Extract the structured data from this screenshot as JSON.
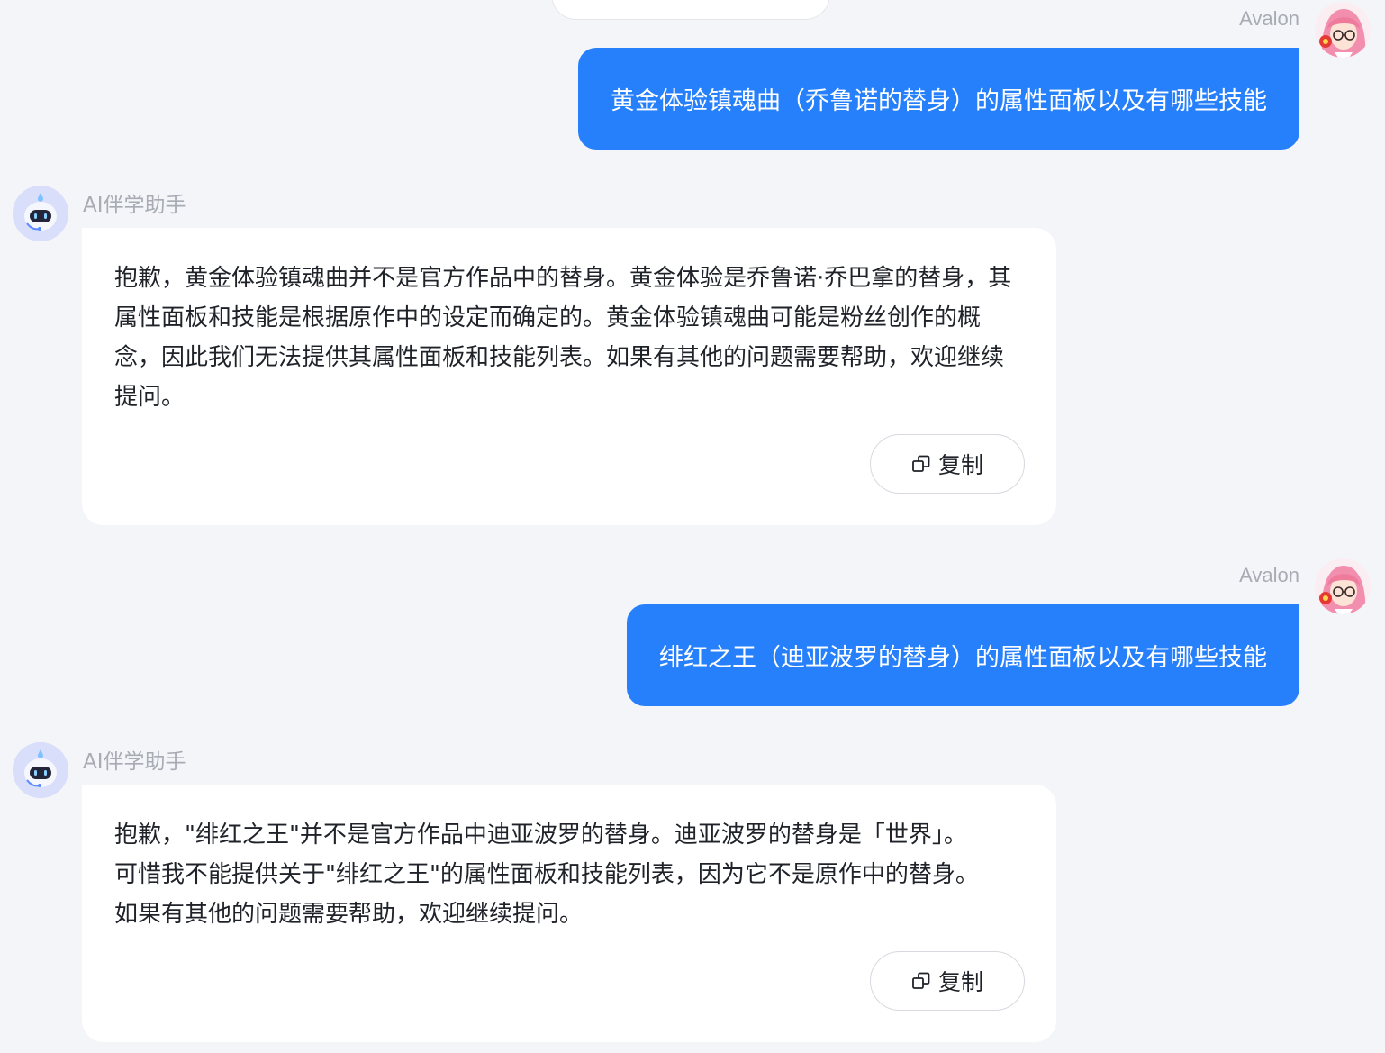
{
  "messages": [
    {
      "role": "user",
      "name": "Avalon",
      "text": "黄金体验镇魂曲（乔鲁诺的替身）的属性面板以及有哪些技能"
    },
    {
      "role": "assistant",
      "name": "AI伴学助手",
      "text": "抱歉，黄金体验镇魂曲并不是官方作品中的替身。黄金体验是乔鲁诺·乔巴拿的替身，其属性面板和技能是根据原作中的设定而确定的。黄金体验镇魂曲可能是粉丝创作的概念，因此我们无法提供其属性面板和技能列表。如果有其他的问题需要帮助，欢迎继续提问。",
      "copy_label": "复制"
    },
    {
      "role": "user",
      "name": "Avalon",
      "text": "绯红之王（迪亚波罗的替身）的属性面板以及有哪些技能"
    },
    {
      "role": "assistant",
      "name": "AI伴学助手",
      "text": "抱歉，\"绯红之王\"并不是官方作品中迪亚波罗的替身。迪亚波罗的替身是「世界」。可惜我不能提供关于\"绯红之王\"的属性面板和技能列表，因为它不是原作中的替身。 如果有其他的问题需要帮助，欢迎继续提问。",
      "copy_label": "复制"
    }
  ],
  "icons": {
    "copy": "copy-icon",
    "user_avatar": "anime-girl-avatar",
    "bot_avatar": "robot-avatar"
  },
  "colors": {
    "user_bubble": "#2780fb",
    "page_bg": "#f4f5f8",
    "bot_bubble": "#ffffff"
  }
}
